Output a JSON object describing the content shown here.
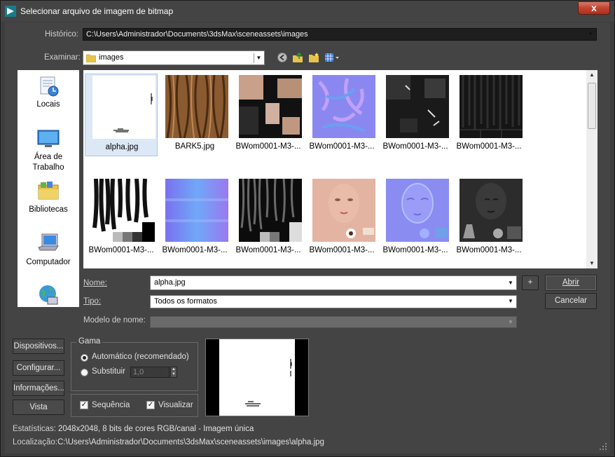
{
  "window": {
    "title": "Selecionar arquivo de imagem de bitmap",
    "close_glyph": "x"
  },
  "history": {
    "label": "Histórico:",
    "value": "C:\\Users\\Administrador\\Documents\\3dsMax\\sceneassets\\images"
  },
  "lookin": {
    "label": "Examinar:",
    "value": "images",
    "icons": [
      "back-icon",
      "up-folder-icon",
      "new-folder-icon",
      "view-menu-icon"
    ]
  },
  "places": [
    {
      "label": "Locais",
      "icon": "recent-places-icon"
    },
    {
      "label": "Área de Trabalho",
      "icon": "desktop-icon"
    },
    {
      "label": "Bibliotecas",
      "icon": "libraries-icon"
    },
    {
      "label": "Computador",
      "icon": "computer-icon"
    },
    {
      "label": "",
      "icon": "network-icon"
    }
  ],
  "files": [
    {
      "name": "alpha.jpg",
      "selected": true
    },
    {
      "name": "BARK5.jpg"
    },
    {
      "name": "BWom0001-M3-..."
    },
    {
      "name": "BWom0001-M3-..."
    },
    {
      "name": "BWom0001-M3-..."
    },
    {
      "name": "BWom0001-M3-..."
    },
    {
      "name": "BWom0001-M3-..."
    },
    {
      "name": "BWom0001-M3-..."
    },
    {
      "name": "BWom0001-M3-..."
    },
    {
      "name": "BWom0001-M3-..."
    },
    {
      "name": "BWom0001-M3-..."
    },
    {
      "name": "BWom0001-M3-..."
    }
  ],
  "form": {
    "name_label": "Nome:",
    "name_value": "alpha.jpg",
    "type_label": "Tipo:",
    "type_value": "Todos os formatos",
    "pattern_label": "Modelo de nome:",
    "pattern_value": "",
    "plus_label": "+",
    "open_label": "Abrir",
    "cancel_label": "Cancelar"
  },
  "left_buttons": {
    "devices": "Dispositivos...",
    "setup": "Configurar...",
    "info": "Informações...",
    "view": "Vista"
  },
  "gamma": {
    "title": "Gama",
    "auto_label": "Automático (recomendado)",
    "override_label": "Substituir",
    "override_value": "1,0",
    "selected": "auto"
  },
  "options": {
    "sequence_label": "Sequência",
    "sequence_checked": true,
    "preview_label": "Visualizar",
    "preview_checked": true
  },
  "stats": {
    "label": "Estatísticas:",
    "value": "2048x2048, 8 bits de cores RGB/canal - Imagem única"
  },
  "location": {
    "label": "Localização:",
    "value": "C:\\Users\\Administrador\\Documents\\3dsMax\\sceneassets\\images\\alpha.jpg"
  },
  "colors": {
    "window_bg": "#444444",
    "list_bg": "#ffffff",
    "selection": "#dde8f6",
    "close": "#c1432f"
  }
}
